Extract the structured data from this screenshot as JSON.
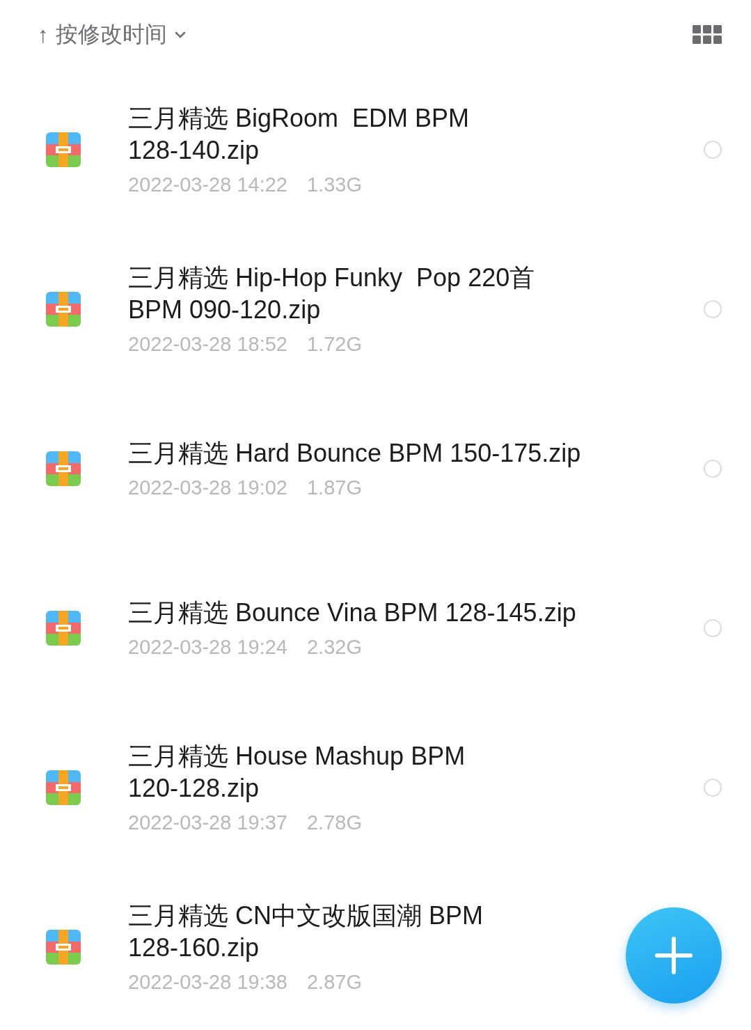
{
  "sort_bar": {
    "arrow": "↑",
    "label": "按修改时间"
  },
  "files": [
    {
      "name": "三月精选 BigRoom  EDM BPM\n128-140.zip",
      "date": "2022-03-28 14:22",
      "size": "1.33G",
      "selected": false
    },
    {
      "name": "三月精选 Hip-Hop Funky  Pop 220首\nBPM 090-120.zip",
      "date": "2022-03-28 18:52",
      "size": "1.72G",
      "selected": false
    },
    {
      "name": "三月精选 Hard Bounce BPM 150-175.zip",
      "date": "2022-03-28 19:02",
      "size": "1.87G",
      "selected": false
    },
    {
      "name": "三月精选 Bounce Vina BPM 128-145.zip",
      "date": "2022-03-28 19:24",
      "size": "2.32G",
      "selected": false
    },
    {
      "name": "三月精选 House Mashup BPM\n120-128.zip",
      "date": "2022-03-28 19:37",
      "size": "2.78G",
      "selected": false
    },
    {
      "name": "三月精选 CN中文改版国潮 BPM\n128-160.zip",
      "date": "2022-03-28 19:38",
      "size": "2.87G"
    }
  ]
}
